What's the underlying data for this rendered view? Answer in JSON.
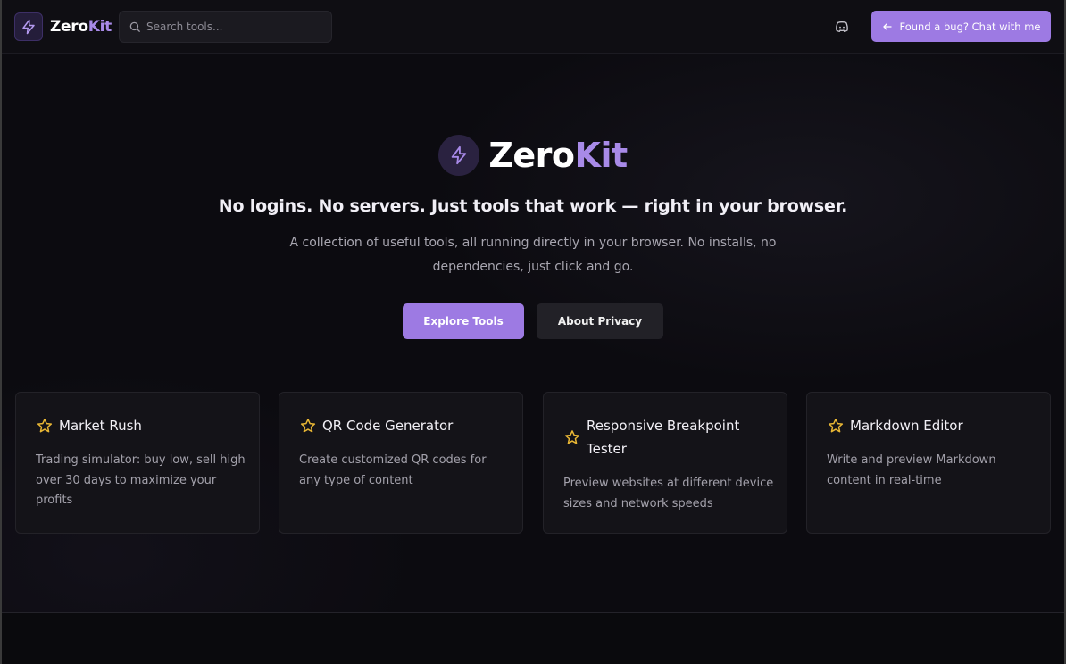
{
  "header": {
    "logo_part1": "Zero",
    "logo_part2": "Kit",
    "search_placeholder": "Search tools...",
    "bug_button_label": "Found a bug? Chat with me"
  },
  "hero": {
    "brand_part1": "Zero",
    "brand_part2": "Kit",
    "tagline": "No logins. No servers. Just tools that work — right in your browser.",
    "description": "A collection of useful tools, all running directly in your browser. No installs, no dependencies, just click and go.",
    "explore_label": "Explore Tools",
    "privacy_label": "About Privacy"
  },
  "cards": [
    {
      "title": "Market Rush",
      "description": "Trading simulator: buy low, sell high over 30 days to maximize your profits",
      "icon": "star-icon"
    },
    {
      "title": "QR Code Generator",
      "description": "Create customized QR codes for any type of content",
      "icon": "star-icon"
    },
    {
      "title": "Responsive Breakpoint Tester",
      "description": "Preview websites at different device sizes and network speeds",
      "icon": "star-icon"
    },
    {
      "title": "Markdown Editor",
      "description": "Write and preview Markdown content in real-time",
      "icon": "star-icon"
    }
  ],
  "colors": {
    "accent": "#9d7ae3",
    "brand_purple": "#a88ae8",
    "star": "#e8b634",
    "background": "#0c0b10",
    "card": "#141318"
  }
}
